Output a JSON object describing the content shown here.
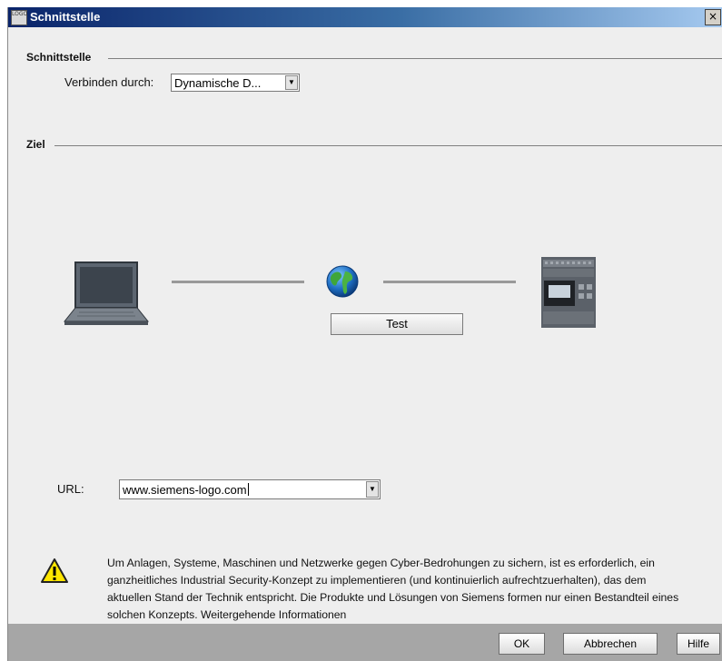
{
  "window": {
    "title": "Schnittstelle",
    "app_icon_text": "LOGO",
    "close_glyph": "×"
  },
  "interface_section": {
    "header": "Schnittstelle",
    "connect_label": "Verbinden durch:",
    "connect_value": "Dynamische D..."
  },
  "target_section": {
    "header": "Ziel",
    "test_label": "Test",
    "icons": [
      "laptop-icon",
      "globe-icon",
      "plc-module-icon"
    ]
  },
  "url": {
    "label": "URL:",
    "value": "www.siemens-logo.com"
  },
  "warning": {
    "icon": "warning-icon",
    "text": "Um Anlagen, Systeme, Maschinen und Netzwerke gegen Cyber-Bedrohungen zu sichern, ist es erforderlich, ein ganzheitliches Industrial Security-Konzept zu implementieren (und kontinuierlich aufrechtzuerhalten), das dem aktuellen Stand der Technik entspricht. Die Produkte und Lösungen von Siemens formen nur einen Bestandteil eines solchen Konzepts. Weitergehende Informationen"
  },
  "buttons": {
    "ok": "OK",
    "cancel": "Abbrechen",
    "help": "Hilfe"
  },
  "colors": {
    "titlebar_start": "#0a246a",
    "titlebar_end": "#a6caf0",
    "dialog_bg": "#eeeeee",
    "button_bar": "#a6a6a6"
  }
}
